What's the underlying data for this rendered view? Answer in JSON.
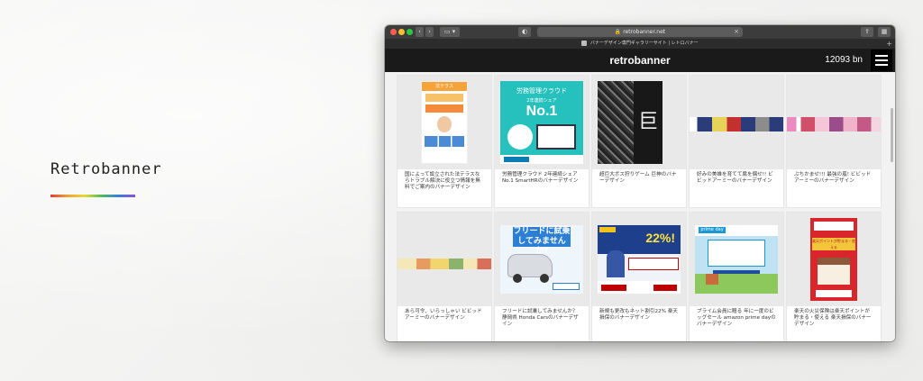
{
  "brand": {
    "title": "Retrobanner"
  },
  "browser": {
    "url": "retrobanner.net",
    "tab_title": "バナーデザイン専門ギャラリーサイト | レトロバナー"
  },
  "site": {
    "logo": "retrobanner",
    "banner_count": "12093 bn"
  },
  "cards": [
    {
      "caption": "国によって設立された法テラスならトラブル解決に役立つ情報を無料でご案内のバナーデザイン",
      "thumb": "houterasu",
      "thumb_text": "法テラス"
    },
    {
      "caption": "労務管理クラウド 2年連続シェア No.1 SmartHRのバナーデザイン",
      "thumb": "smarthr",
      "thumb_text": [
        "労務管理クラウド",
        "2年連続シェア",
        "No.1"
      ]
    },
    {
      "caption": "超巨大ボス狩りゲーム 巨神のバナーデザイン",
      "thumb": "kyoshin",
      "thumb_text": "巨神"
    },
    {
      "caption": "好みの美雄を育てて腐を偶せ!! ビビッドアーミーのバナーデザイン",
      "thumb": "strip-army"
    },
    {
      "caption": "ぶちかませ!!! 最強の嵐! ビビッドアーミーのバナーデザイン",
      "thumb": "strip-pink"
    },
    {
      "caption": "あら可令、いらっしゃい ビビッドアーミーのバナーデザイン",
      "thumb": "strip-yellow"
    },
    {
      "caption": "フリードに試乗してみませんか？静岡県 Honda Carsのバナーデザイン",
      "thumb": "honda",
      "thumb_text": "フリードに試乗してみませんか?"
    },
    {
      "caption": "新規も更改もネット割引22% 楽天損保のバナーデザイン",
      "thumb": "rakuten-sonpo",
      "thumb_text": "22%!"
    },
    {
      "caption": "プライム会員に贈る 年に一度のビッグセール amazon prime dayのバナーデザイン",
      "thumb": "primeday",
      "thumb_text": "prime day"
    },
    {
      "caption": "楽天の火災保険は楽天ポイントが貯まる・使える 楽天損保のバナーデザイン",
      "thumb": "rakuten-kasai",
      "thumb_text": "楽天ポイントが貯まる・使える"
    }
  ],
  "colors": {
    "site_header": "#1a1a1a",
    "accent_rainbow": [
      "#e63b3b",
      "#f0a030",
      "#e9d93a",
      "#4bbf5a",
      "#3a7fe0",
      "#8a4fd6"
    ]
  },
  "icons": {
    "traffic_lights": [
      "close",
      "minimize",
      "zoom"
    ],
    "menu": "hamburger-icon",
    "reader": "reader-icon",
    "share": "share-icon",
    "tabs": "tabs-icon"
  }
}
